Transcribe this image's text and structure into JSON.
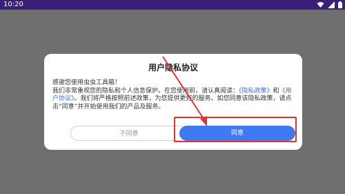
{
  "statusbar": {
    "time": "10:20",
    "icons": [
      "wifi-icon",
      "signal-icon",
      "battery-icon"
    ]
  },
  "dialog": {
    "title": "用户隐私协议",
    "line1": "感谢您使用虫虫工具箱！",
    "line2_a": "我们非常重视您的隐私和个人信息保护。在您使用前，请认真阅读：",
    "link_privacy": "《隐私政策》",
    "line2_b": "和",
    "link_agreement": "《用户协议》",
    "line3": "。我们将严格按照前述政策，为您提供更好的服务。如您同意该隐私政策，请点击“同意”并开始使用我们的产品及服务。",
    "disagree_label": "不同意",
    "agree_label": "同意"
  },
  "colors": {
    "statusbar": "#3a1f78",
    "overlay": "#6f6f6f",
    "agree_button": "#3f7af2",
    "highlight": "#e33030",
    "link": "#3b6fe0"
  }
}
